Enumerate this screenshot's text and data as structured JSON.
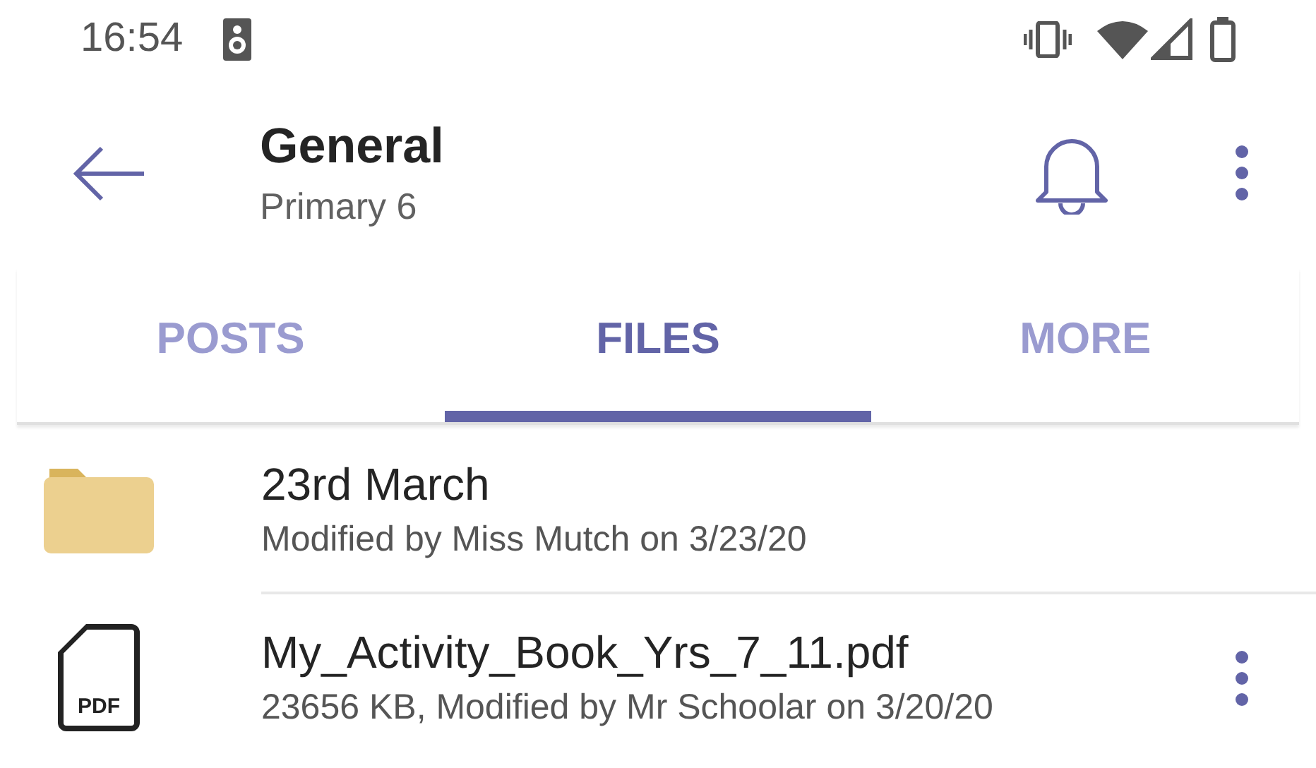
{
  "status_bar": {
    "time": "16:54"
  },
  "header": {
    "title": "General",
    "subtitle": "Primary 6"
  },
  "tabs": [
    {
      "label": "POSTS",
      "selected": false
    },
    {
      "label": "FILES",
      "selected": true
    },
    {
      "label": "MORE",
      "selected": false
    }
  ],
  "files": [
    {
      "kind": "folder",
      "name": "23rd March",
      "details": "Modified by Miss Mutch on 3/23/20"
    },
    {
      "kind": "file",
      "name": "My_Activity_Book_Yrs_7_11.pdf",
      "details": "23656 KB, Modified by Mr Schoolar on 3/20/20",
      "icon_label": "PDF"
    }
  ]
}
